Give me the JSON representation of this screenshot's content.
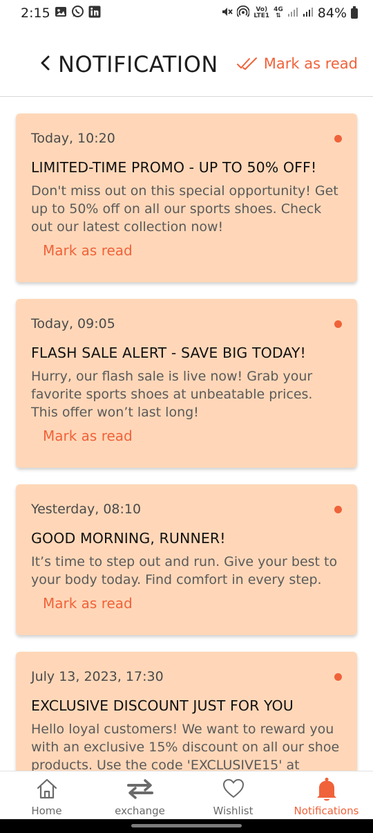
{
  "status_bar": {
    "time": "2:15",
    "net_top": "Vo)",
    "net_bottom": "LTE1",
    "gen_top": "4G",
    "battery": "84%"
  },
  "header": {
    "title": "NOTIFICATION",
    "mark_all_label": "Mark as read"
  },
  "notifications": [
    {
      "time": "Today, 10:20",
      "title": "LIMITED-TIME PROMO - UP TO 50% OFF!",
      "body": "Don't miss out on this special opportunity! Get up to 50% off on all our sports shoes. Check out our latest collection now!",
      "action": "Mark as read",
      "unread": true
    },
    {
      "time": "Today, 09:05",
      "title": "FLASH SALE ALERT - SAVE BIG TODAY!",
      "body": "Hurry, our flash sale is live now! Grab your favorite sports shoes at unbeatable prices. This offer won’t last long!",
      "action": "Mark as read",
      "unread": true
    },
    {
      "time": "Yesterday, 08:10",
      "title": "GOOD MORNING, RUNNER!",
      "body": "It’s time to step out and run. Give your best to your body today. Find comfort in every step.",
      "action": "Mark as read",
      "unread": true
    },
    {
      "time": "July 13, 2023, 17:30",
      "title": "EXCLUSIVE DISCOUNT JUST FOR YOU",
      "body": "Hello loyal customers! We want to reward you with an exclusive 15% discount on all our shoe products. Use the code 'EXCLUSIVE15' at",
      "unread": true
    }
  ],
  "bottom_nav": {
    "items": [
      {
        "label": "Home",
        "icon": "home-icon"
      },
      {
        "label": "exchange",
        "icon": "exchange-icon"
      },
      {
        "label": "Wishlist",
        "icon": "heart-icon"
      },
      {
        "label": "Notifications",
        "icon": "bell-icon"
      }
    ],
    "active_index": 3
  },
  "colors": {
    "accent": "#f0623a",
    "card_background": "#ffd7b8",
    "text_dark": "#111111",
    "text_muted": "#5a5a5a"
  }
}
